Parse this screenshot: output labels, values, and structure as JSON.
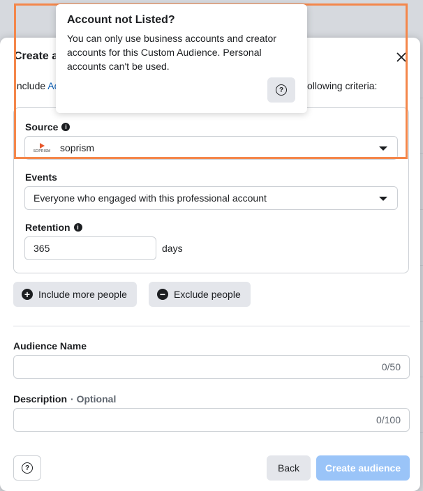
{
  "modal": {
    "title": "Create a",
    "include_prefix": "Include",
    "include_link": "Ac",
    "include_suffix": "ollowing criteria:"
  },
  "source": {
    "label": "Source",
    "account_name": "soprism",
    "logo_text": "SOPRISM"
  },
  "events": {
    "label": "Events",
    "selected": "Everyone who engaged with this professional account"
  },
  "retention": {
    "label": "Retention",
    "value": "365",
    "unit": "days"
  },
  "actions": {
    "include_more": "Include more people",
    "exclude": "Exclude people"
  },
  "audience_name": {
    "label": "Audience Name",
    "counter": "0/50"
  },
  "description": {
    "label": "Description",
    "optional": "· Optional",
    "counter": "0/100"
  },
  "footer": {
    "back": "Back",
    "create": "Create audience"
  },
  "tooltip": {
    "title": "Account not Listed?",
    "body": "You can only use business accounts and creator accounts for this Custom Audience. Personal accounts can't be used."
  },
  "colors": {
    "highlight": "#f4874b",
    "link": "#0a5eb5",
    "primary_disabled": "#9ac4f8"
  }
}
